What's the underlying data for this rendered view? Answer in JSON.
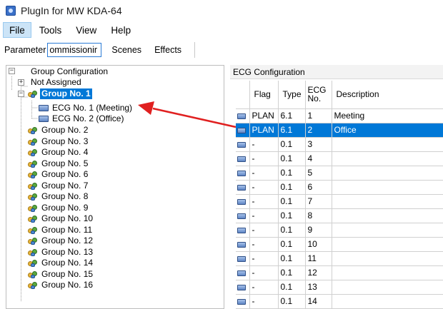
{
  "window": {
    "title": "PlugIn for MW KDA-64"
  },
  "menu": {
    "items": [
      "File",
      "Tools",
      "View",
      "Help"
    ]
  },
  "tabs": {
    "parameter_label": "Parameter",
    "commissioning_field": "ommissionir",
    "scenes": "Scenes",
    "effects": "Effects"
  },
  "tree": {
    "root": "Group Configuration",
    "not_assigned": "Not Assigned",
    "selected_group": "Group No. 1",
    "ecg_children": [
      "ECG No. 1 (Meeting)",
      "ECG No. 2 (Office)"
    ],
    "groups": [
      "Group No. 2",
      "Group No. 3",
      "Group No. 4",
      "Group No. 5",
      "Group No. 6",
      "Group No. 7",
      "Group No. 8",
      "Group No. 9",
      "Group No. 10",
      "Group No. 11",
      "Group No. 12",
      "Group No. 13",
      "Group No. 14",
      "Group No. 15",
      "Group No. 16"
    ],
    "expander_expanded": "−",
    "expander_collapsed": "+"
  },
  "ecg": {
    "title": "ECG Configuration",
    "columns": [
      "",
      "Flag",
      "Type",
      "ECG No.",
      "Description"
    ],
    "column_ecg_no_lines": [
      "ECG",
      "No."
    ],
    "rows": [
      {
        "flag": "PLAN",
        "type": "6.1",
        "no": "1",
        "desc": "Meeting",
        "selected": false
      },
      {
        "flag": "PLAN",
        "type": "6.1",
        "no": "2",
        "desc": "Office",
        "selected": true
      },
      {
        "flag": "-",
        "type": "0.1",
        "no": "3",
        "desc": "",
        "selected": false
      },
      {
        "flag": "-",
        "type": "0.1",
        "no": "4",
        "desc": "",
        "selected": false
      },
      {
        "flag": "-",
        "type": "0.1",
        "no": "5",
        "desc": "",
        "selected": false
      },
      {
        "flag": "-",
        "type": "0.1",
        "no": "6",
        "desc": "",
        "selected": false
      },
      {
        "flag": "-",
        "type": "0.1",
        "no": "7",
        "desc": "",
        "selected": false
      },
      {
        "flag": "-",
        "type": "0.1",
        "no": "8",
        "desc": "",
        "selected": false
      },
      {
        "flag": "-",
        "type": "0.1",
        "no": "9",
        "desc": "",
        "selected": false
      },
      {
        "flag": "-",
        "type": "0.1",
        "no": "10",
        "desc": "",
        "selected": false
      },
      {
        "flag": "-",
        "type": "0.1",
        "no": "11",
        "desc": "",
        "selected": false
      },
      {
        "flag": "-",
        "type": "0.1",
        "no": "12",
        "desc": "",
        "selected": false
      },
      {
        "flag": "-",
        "type": "0.1",
        "no": "13",
        "desc": "",
        "selected": false
      },
      {
        "flag": "-",
        "type": "0.1",
        "no": "14",
        "desc": "",
        "selected": false
      }
    ]
  },
  "colors": {
    "selection": "#0078d7",
    "menu_active": "#cce4f7",
    "annotation_arrow": "#e02020"
  },
  "icons": {
    "app": "app-icon",
    "group": "group-icon",
    "ecg": "ecg-icon"
  }
}
